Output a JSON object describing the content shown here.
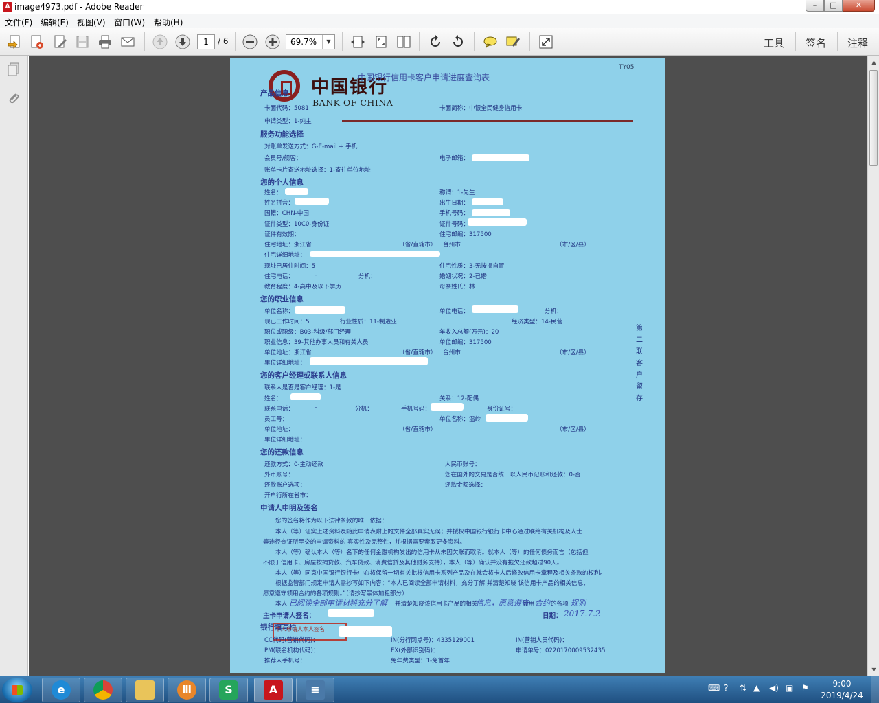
{
  "window": {
    "title": "image4973.pdf - Adobe Reader",
    "minimize": "–",
    "maximize": "□",
    "close": "✕"
  },
  "menu": {
    "items": [
      "文件(F)",
      "编辑(E)",
      "视图(V)",
      "窗口(W)",
      "帮助(H)"
    ]
  },
  "toolbar": {
    "current_page": "1",
    "total_pages": "/ 6",
    "zoom": "69.7%",
    "zoom_arrow": "▼",
    "tools_label": "工具",
    "sign_label": "签名",
    "comment_label": "注释"
  },
  "icons": {
    "create": "create-pdf-icon",
    "combine": "combine-icon",
    "edit": "edit-icon",
    "save": "save-icon",
    "print": "print-icon",
    "email": "email-icon",
    "prev_page": "arrow-up-icon",
    "next_page": "arrow-down-icon",
    "zoom_out": "minus-circle-icon",
    "zoom_in": "plus-circle-icon",
    "fit_width": "fit-width-icon",
    "fit_page": "fit-page-icon",
    "two_page": "two-page-icon",
    "rotate_ccw": "rotate-ccw-icon",
    "rotate_cw": "rotate-cw-icon",
    "comment": "speech-bubble-icon",
    "highlight": "highlight-pen-icon",
    "fullscreen": "expand-icon",
    "pages_panel": "pages-icon",
    "attachments_panel": "paperclip-icon"
  },
  "document": {
    "form_code": "TY05",
    "logo_cn": "中国银行",
    "logo_en": "BANK OF CHINA",
    "title": "中国银行信用卡客户申请进度查询表",
    "side_text": "第二联客户留存",
    "lines": {
      "product": "产品信息",
      "card_code": "卡面代码：5081",
      "card_name": "卡面简称：中银全民健身信用卡",
      "apply_type": "申请类型：1-纯主",
      "services": "服务功能选择",
      "statement": "对账单发送方式：G-E-mail + 手机",
      "member": "会员号/舰客：",
      "email": "电子邮箱：",
      "mail_addr": "账单卡片寄送地址选择：1-寄往单位地址",
      "personal": "您的个人信息",
      "name": "姓名：",
      "title_field": "称谓：1-先生",
      "pinyin": "姓名拼音：",
      "birth": "出生日期：",
      "nation": "国籍：CHN-中国",
      "mobile": "手机号码：",
      "id_type": "证件类型：10C0-身份证",
      "id_no": "证件号码：",
      "id_valid": "证件有效期：",
      "home_zip": "住宅邮编：317500",
      "home_addr": "住宅地址：浙江省",
      "province": "（省/直辖市）",
      "city": "台州市",
      "district": "（市/区/县）",
      "home_detail": "住宅详细地址：",
      "years_live": "现址已居住时间：5",
      "home_type": "住宅性质：3-无按揭自置",
      "home_phone": "住宅电话：",
      "dash": "–",
      "ext": "分机：",
      "marital": "婚姻状况：2-已婚",
      "education": "教育程度：4-高中及以下学历",
      "mother": "母亲姓氏：林",
      "work": "您的职业信息",
      "employer": "单位名称：",
      "work_phone": "单位电话：",
      "work_years": "现已工作时间：5",
      "industry": "行业性质：11-制造业",
      "econ_type": "经济类型：14-民营",
      "position": "职位或职级：B03-科级/部门经理",
      "income": "年收入总额(万元)：20",
      "occupation": "职业信息：39-其他办事人员和有关人员",
      "work_zip": "单位邮编：317500",
      "work_addr": "单位地址：浙江省",
      "work_detail": "单位详细地址：",
      "contact": "您的客户经理或联系人信息",
      "is_manager": "联系人是否是客户经理：1-是",
      "relation": "关系：12-配偶",
      "contact_phone": "联系电话：",
      "contact_mobile": "手机号码：",
      "contact_id": "身份证号：",
      "staff_no": "员工号：",
      "contact_employer": "单位名称：温岭",
      "contact_addr": "单位地址：",
      "contact_detail": "单位详细地址：",
      "repay": "您的还款信息",
      "repay_method": "还款方式：0-主动还款",
      "rmb_account": "人民币账号：",
      "fx_account": "外币账号：",
      "overseas": "您在国外的交易是否统一以人民币记账和还款：0-否",
      "repay_option": "还款账户选项：",
      "repay_amount": "还款金额选择：",
      "open_bank": "开户行所在省市：",
      "declare": "申请人申明及签名",
      "decl_1": "您的签名将作为以下法律条款的唯一依据：",
      "decl_2": "本人（等）证实上述资料及随此申请表附上的文件全部真实无误；并授权中国银行银行卡中心通过联络有关机构及人士",
      "decl_3": "等途径查证所呈交的申请资料的 真实性及完整性，并根据需要索取更多资料。",
      "decl_4": "本人（等）确认本人（等）名下的任何金融机构发出的信用卡从未因欠账而取消。就本人（等）的任何债务而言（包括但",
      "decl_5": "不限于信用卡、房屋按揭贷款、汽车贷款、消费信贷及其他财务支持），本人（等）确认并没有拖欠还款超过90天。",
      "decl_6": "本人（等）同意中国银行银行卡中心将保留一切有关批核信用卡系列产品及在就会将卡人后修改信用卡章程及相关条款的权利。",
      "decl_7": "根据监管部门规定申请人需抄写如下内容：“本人已阅读全部申请材料，充分了解 并清楚知晓 该信用卡产品的相关信息，",
      "decl_8": "愿意遵守领用合约的各项规则。”（请抄写黑体加粗部分）",
      "decl_9": "本人",
      "decl_9b": "并清楚知晓该信用卡产品的相关",
      "decl_9c": "领用",
      "decl_9d": "的各项",
      "main_sign": "主卡申请人签名：",
      "date": "日期：",
      "bank_fill": "银行填写栏",
      "cc_code": "CC代码(营销代码)：",
      "branch_code": "IN(分行网点号)：4335129001",
      "in_code": "IN(营销人员代码)：",
      "pm_code": "PM(联名机构代码)：",
      "ex_code": "EX(外部识别码)：",
      "app_no": "申请单号：0220170009532435",
      "referrer": "推荐人手机号：",
      "fee_type": "免年费类型：1-免首年"
    },
    "handwriting": {
      "copy_text": "已阅读全部申请材料充分了解",
      "copy_info": "信息，愿意遵守",
      "copy_contract": "合约",
      "copy_rules": "规则",
      "sign_date": "2017.7.2"
    },
    "stamp_text": "本人申请人本人签名"
  },
  "taskbar": {
    "time": "9:00",
    "date": "2019/4/24",
    "apps": [
      "internet-explorer-icon",
      "chrome-icon",
      "file-explorer-icon",
      "baidu-netdisk-icon",
      "wps-sheets-icon",
      "adobe-reader-icon",
      "scanner-icon"
    ]
  }
}
